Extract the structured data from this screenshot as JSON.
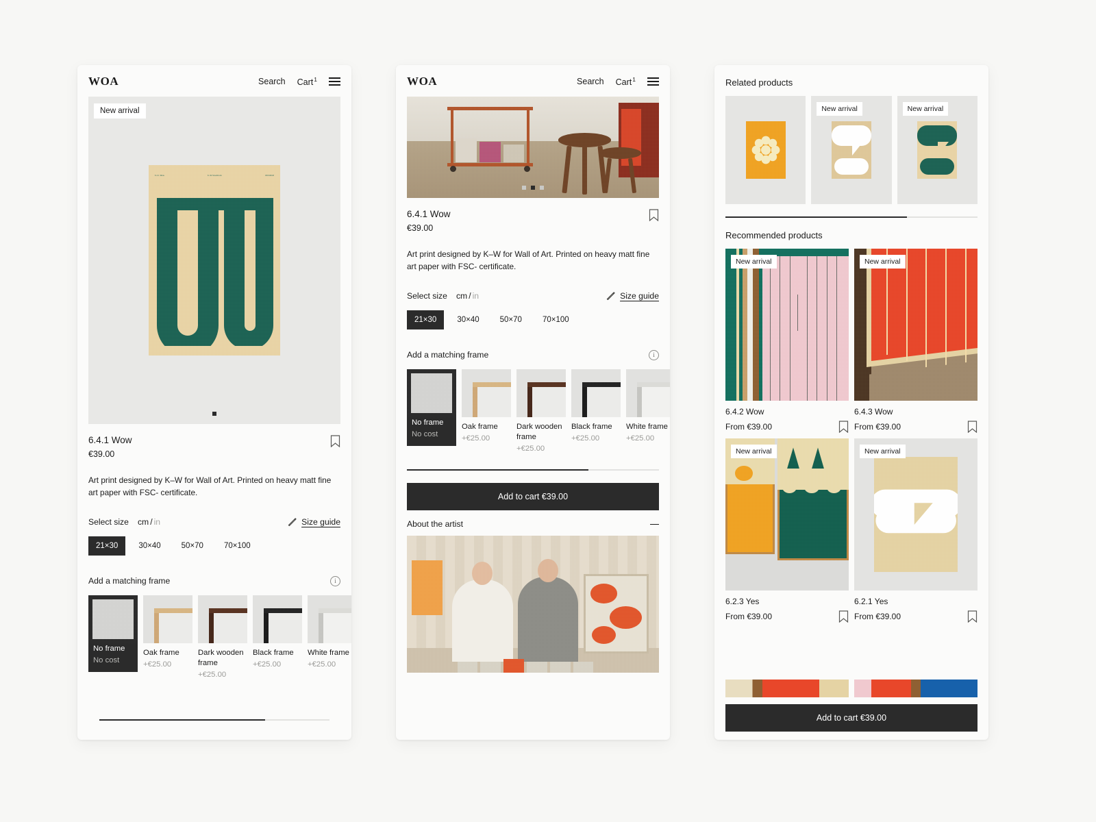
{
  "header": {
    "logo": "WOA",
    "search_label": "Search",
    "cart_label": "Cart",
    "cart_count": "1",
    "menu_icon": "hamburger-icon"
  },
  "badges": {
    "new_arrival": "New arrival"
  },
  "product": {
    "title": "6.4.1 Wow",
    "price": "€39.00",
    "description": "Art print designed by K–W for Wall of Art. Printed on heavy matt fine art paper with FSC- certificate.",
    "size_label": "Select size",
    "unit_cm": "cm",
    "unit_sep": "/",
    "unit_in": "in",
    "size_guide": "Size guide",
    "sizes": [
      "21×30",
      "30×40",
      "50×70",
      "70×100"
    ],
    "selected_size": "21×30",
    "frame_label": "Add a matching frame",
    "frames": [
      {
        "name": "No frame",
        "price": "No cost",
        "selected": true
      },
      {
        "name": "Oak frame",
        "price": "+€25.00",
        "selected": false
      },
      {
        "name": "Dark wooden frame",
        "price": "+€25.00",
        "selected": false
      },
      {
        "name": "Black frame",
        "price": "+€25.00",
        "selected": false
      },
      {
        "name": "White frame",
        "price": "+€25.00",
        "selected": false
      }
    ],
    "add_to_cart": "Add to cart €39.00",
    "about_artist": "About the artist",
    "poster_micro_left": "6.4.1 Wow",
    "poster_micro_mid": "K–W\nStockholm",
    "poster_micro_right": "30X40CM"
  },
  "right": {
    "related_title": "Related products",
    "recommended_title": "Recommended products",
    "add_to_cart": "Add to cart €39.00",
    "related": [
      {
        "badge": "",
        "art": "flower"
      },
      {
        "badge": "New arrival",
        "art": "yes-cream"
      },
      {
        "badge": "New arrival",
        "art": "yes-green"
      }
    ],
    "recommended": [
      {
        "badge": "New arrival",
        "name": "6.4.2 Wow",
        "price": "From €39.00",
        "art": "pink-stripes"
      },
      {
        "badge": "New arrival",
        "name": "6.4.3 Wow",
        "price": "From €39.00",
        "art": "red-wow"
      },
      {
        "badge": "New arrival",
        "name": "6.2.3 Yes",
        "price": "From €39.00",
        "art": "orange-green"
      },
      {
        "badge": "New arrival",
        "name": "6.2.1 Yes",
        "price": "From €39.00",
        "art": "cream-yes"
      }
    ]
  },
  "colors": {
    "page_bg": "#f7f7f5",
    "panel_bg": "#fbfbfa",
    "ink": "#1a1a1a",
    "dark": "#2b2b2b",
    "poster_cream": "#e9d4a6",
    "poster_green": "#1d6354",
    "muted": "#9b9b98",
    "placeholder_gray": "#e6e6e4"
  },
  "progress": {
    "left_panel_pct": 72,
    "related_pct": 72
  }
}
